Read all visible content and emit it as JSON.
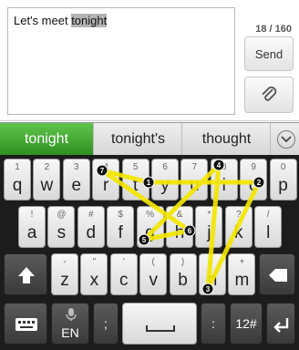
{
  "compose": {
    "text_before": "Let's meet ",
    "text_highlight": "tonight",
    "counter": "18 / 160",
    "send_label": "Send"
  },
  "suggestions": [
    {
      "label": "tonight"
    },
    {
      "label": "tonight's"
    },
    {
      "label": "thought"
    }
  ],
  "keyboard": {
    "row1": [
      {
        "alt": "1",
        "main": "q"
      },
      {
        "alt": "2",
        "main": "w"
      },
      {
        "alt": "3",
        "main": "e"
      },
      {
        "alt": "4",
        "main": "r"
      },
      {
        "alt": "5",
        "main": "t"
      },
      {
        "alt": "6",
        "main": "y"
      },
      {
        "alt": "7",
        "main": "u"
      },
      {
        "alt": "8",
        "main": "i"
      },
      {
        "alt": "9",
        "main": "o"
      },
      {
        "alt": "0",
        "main": "p"
      }
    ],
    "row2": [
      {
        "alt": "!",
        "main": "a"
      },
      {
        "alt": "@",
        "main": "s"
      },
      {
        "alt": "#",
        "main": "d"
      },
      {
        "alt": "$",
        "main": "f"
      },
      {
        "alt": "%",
        "main": "g"
      },
      {
        "alt": "&",
        "main": "h"
      },
      {
        "alt": "*",
        "main": "j"
      },
      {
        "alt": "?",
        "main": "k"
      },
      {
        "alt": "/",
        "main": "l"
      }
    ],
    "row3": [
      {
        "alt": "-",
        "main": "z"
      },
      {
        "alt": "\"",
        "main": "x"
      },
      {
        "alt": "'",
        "main": "c"
      },
      {
        "alt": "(",
        "main": "v"
      },
      {
        "alt": ")",
        "main": "b"
      },
      {
        "alt": "",
        "main": "n"
      },
      {
        "alt": "+",
        "main": "m"
      }
    ],
    "lang": "EN",
    "num_label": "12#",
    "bottom_punct": [
      ";",
      ":"
    ],
    "accent": "#f2e600"
  },
  "trace_markers": [
    "1",
    "2",
    "3",
    "4",
    "5",
    "6",
    "7"
  ]
}
